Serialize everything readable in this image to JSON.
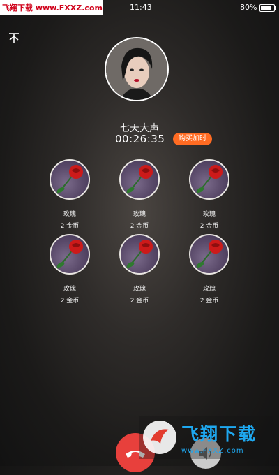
{
  "status_bar": {
    "time": "11:43",
    "battery_percent": "80%",
    "watermark_text": "飞翔下载 www.FXXZ.com"
  },
  "call": {
    "caller_name": "七天大声",
    "timer": "00:26:35",
    "buy_time_label": "购买加时"
  },
  "gifts": [
    {
      "name": "玫瑰",
      "price": "2 金币"
    },
    {
      "name": "玫瑰",
      "price": "2 金币"
    },
    {
      "name": "玫瑰",
      "price": "2 金币"
    },
    {
      "name": "玫瑰",
      "price": "2 金币"
    },
    {
      "name": "玫瑰",
      "price": "2 金币"
    },
    {
      "name": "玫瑰",
      "price": "2 金币"
    }
  ],
  "watermark": {
    "title": "飞翔下载",
    "url": "www.FXXZ.com"
  },
  "colors": {
    "buy_button": "#ff6b22",
    "hangup": "#e8403c",
    "watermark": "#1ea8f0"
  },
  "icons": {
    "collapse": "collapse-icon",
    "hangup": "phone-hangup-icon",
    "speaker": "speaker-icon",
    "gift": "rose-icon"
  }
}
